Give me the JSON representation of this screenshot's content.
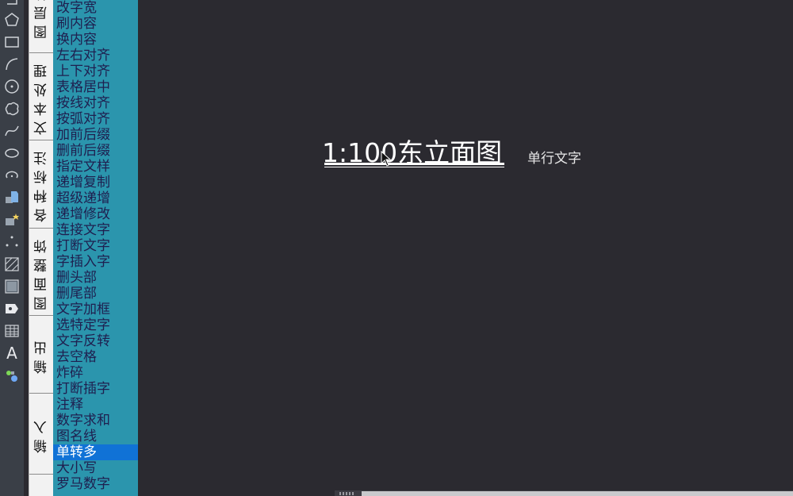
{
  "toolbar": {
    "tools": [
      "polyline-icon",
      "polygon-icon",
      "rectangle-icon",
      "arc-icon",
      "circle-icon",
      "revcloud-icon",
      "spline-icon",
      "ellipse-icon",
      "ellipse-arc-icon",
      "insert-block-icon",
      "make-block-icon",
      "point-icon",
      "hatch-icon",
      "gradient-icon",
      "region-icon",
      "table-icon",
      "multiline-text-icon",
      "add-selected-icon"
    ],
    "text_tool_glyph": "A"
  },
  "tabs": [
    {
      "label": "图层管"
    },
    {
      "label": "文本处理"
    },
    {
      "label": "各种标注"
    },
    {
      "label": "图面整饰"
    },
    {
      "label": "输出"
    },
    {
      "label": "输入"
    }
  ],
  "commands": [
    "改字宽",
    "刷内容",
    "换内容",
    "左右对齐",
    "上下对齐",
    "表格居中",
    "按线对齐",
    "按弧对齐",
    "加前后缀",
    "删前后缀",
    "指定文样",
    "递增复制",
    "超级递增",
    "递增修改",
    "连接文字",
    "打断文字",
    "字插入字",
    "删头部",
    "删尾部",
    "文字加框",
    "选特定字",
    "文字反转",
    "去空格",
    "炸碎",
    "打断插字",
    "注释",
    "数字求和",
    "图名线",
    "单转多",
    "大小写",
    "罗马数字"
  ],
  "selected_command": "单转多",
  "canvas": {
    "title": "1:100东立面图",
    "label": "单行文字"
  },
  "colors": {
    "canvas_bg": "#2b2a30",
    "panel_bg": "#2b95ad",
    "selection": "#1072d6",
    "command_text": "#1f1f4f"
  }
}
